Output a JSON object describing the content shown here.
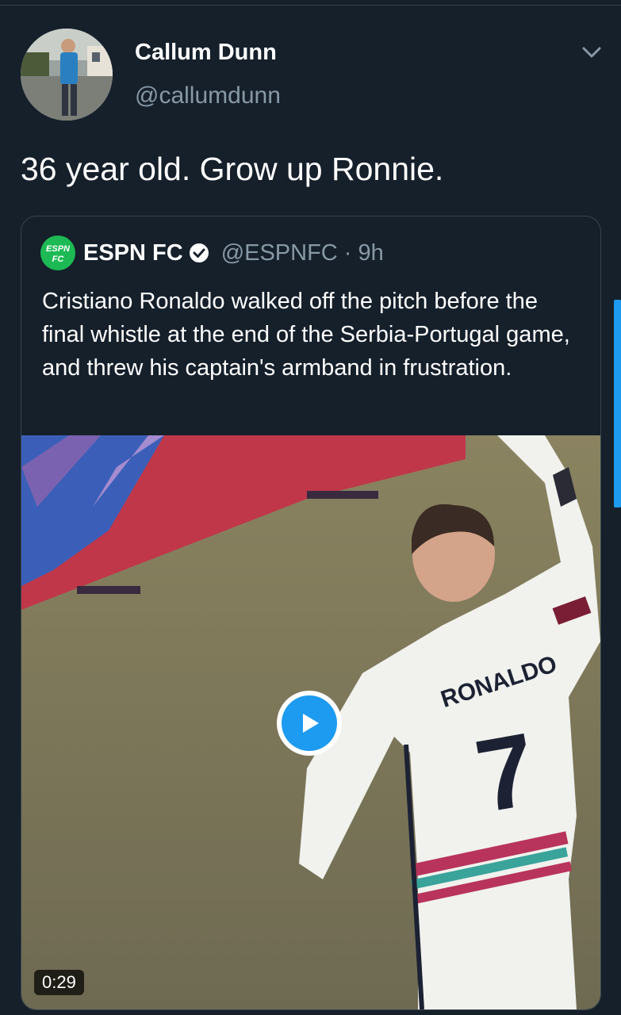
{
  "tweet": {
    "display_name": "Callum Dunn",
    "handle": "@callumdunn",
    "text": "36 year old. Grow up Ronnie.",
    "avatar_icon": "profile-photo",
    "menu_icon": "chevron-down-icon"
  },
  "quote": {
    "logo_text_top": "ESPN",
    "logo_text_bottom": "FC",
    "display_name": "ESPN FC",
    "verified_icon": "verified-badge-icon",
    "handle": "@ESPNFC",
    "separator": "·",
    "time": "9h",
    "text": "Cristiano Ronaldo walked off the pitch before the final whistle at the end of the Serbia-Portugal game, and threw his captain's armband in frustration."
  },
  "media": {
    "jersey_name": "RONALDO",
    "jersey_number": "7",
    "play_icon": "play-icon",
    "duration": "0:29"
  },
  "colors": {
    "background": "#15202b",
    "secondary_text": "#8899a6",
    "accent": "#1d9bf0",
    "border": "#38444d",
    "espn_green": "#1db954"
  }
}
